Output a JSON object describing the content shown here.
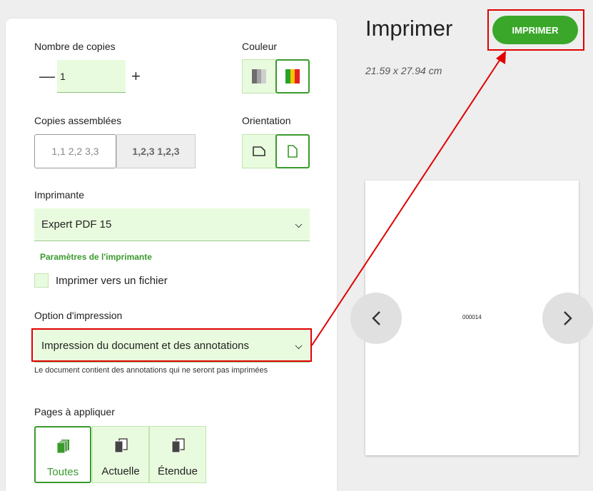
{
  "header": {
    "title": "Imprimer",
    "print_button": "IMPRIMER",
    "page_size": "21.59 x 27.94 cm"
  },
  "copies": {
    "label": "Nombre de copies",
    "value": "1"
  },
  "color": {
    "label": "Couleur",
    "options": [
      "grayscale-icon",
      "color-icon"
    ],
    "selected": "color"
  },
  "collate": {
    "label": "Copies assemblées",
    "uncollated": "1,1 2,2 3,3",
    "collated": "1,2,3 1,2,3"
  },
  "orientation": {
    "label": "Orientation",
    "options": [
      "landscape-icon",
      "portrait-icon"
    ],
    "selected": "portrait"
  },
  "printer": {
    "label": "Imprimante",
    "value": "Expert PDF 15",
    "settings_link": "Paramètres de l'imprimante",
    "print_to_file": "Imprimer vers un fichier"
  },
  "print_option": {
    "label": "Option d'impression",
    "value": "Impression du document et des annotations",
    "hint": "Le document contient des annotations qui ne seront pas imprimées"
  },
  "pages": {
    "label": "Pages à appliquer",
    "options": [
      "Toutes",
      "Actuelle",
      "Étendue"
    ],
    "selected": "Toutes"
  },
  "preview": {
    "page_number": "000014"
  },
  "colors": {
    "accent": "#3aa72a",
    "light_green": "#e9fbde",
    "highlight": "#e00000"
  }
}
